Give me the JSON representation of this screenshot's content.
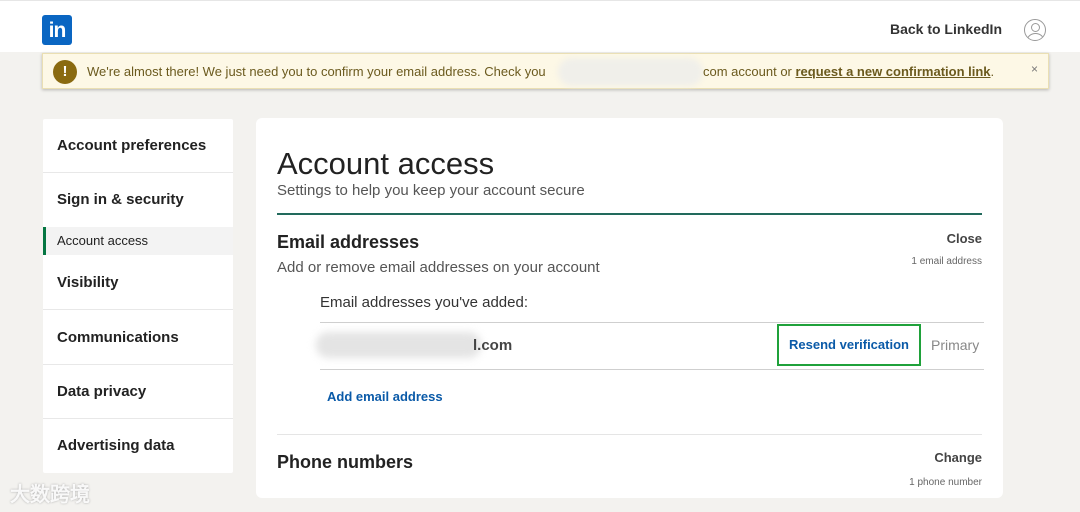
{
  "header": {
    "logo_text": "in",
    "back_link": "Back to LinkedIn"
  },
  "banner": {
    "icon": "!",
    "text_before": "We're almost there! We just need you to confirm your email address. Check you",
    "text_after": "com account or ",
    "link": "request a new confirmation link",
    "text_end": ".",
    "close": "×"
  },
  "sidebar": {
    "items": [
      {
        "label": "Account preferences"
      },
      {
        "label": "Sign in & security"
      },
      {
        "label": "Visibility"
      },
      {
        "label": "Communications"
      },
      {
        "label": "Data privacy"
      },
      {
        "label": "Advertising data"
      }
    ],
    "active_subitem": "Account access"
  },
  "main": {
    "title": "Account access",
    "subtitle": "Settings to help you keep your account secure",
    "email_section": {
      "title": "Email addresses",
      "action": "Close",
      "description": "Add or remove email addresses on your account",
      "count": "1 email address",
      "added_label": "Email addresses you've added:",
      "email_suffix": "l.com",
      "resend_button": "Resend verification",
      "primary_tag": "Primary",
      "add_email": "Add email address"
    },
    "phone_section": {
      "title": "Phone numbers",
      "action": "Change",
      "count": "1 phone number"
    }
  },
  "watermark": "大数跨境"
}
